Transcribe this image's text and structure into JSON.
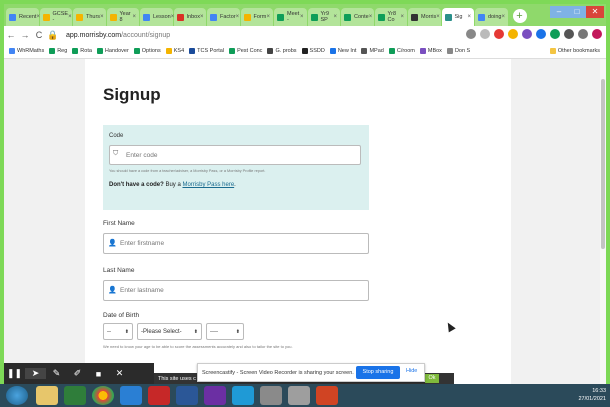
{
  "browser": {
    "tabs": [
      {
        "label": "Recent",
        "color": "#4285f4"
      },
      {
        "label": "GCSE -",
        "color": "#f4b400"
      },
      {
        "label": "Thurs",
        "color": "#f4b400"
      },
      {
        "label": "Year 8",
        "color": "#f4b400"
      },
      {
        "label": "Lesson",
        "color": "#4285f4"
      },
      {
        "label": "Inbox",
        "color": "#d93025"
      },
      {
        "label": "Factor",
        "color": "#4285f4"
      },
      {
        "label": "Form",
        "color": "#f4b400"
      },
      {
        "label": "Meet -",
        "color": "#0f9d58"
      },
      {
        "label": "Yr9 SP",
        "color": "#0f9d58"
      },
      {
        "label": "Conte",
        "color": "#0f9d58"
      },
      {
        "label": "Yr8 Co",
        "color": "#0f9d58"
      },
      {
        "label": "Morris",
        "color": "#333333"
      },
      {
        "label": "Sig",
        "color": "#2a8f8a",
        "active": true
      },
      {
        "label": "doing",
        "color": "#4285f4"
      }
    ],
    "url_host": "app.morrisby.com",
    "url_path": "/account/signup",
    "bookmarks": [
      {
        "label": "WhRMaths",
        "color": "#4285f4"
      },
      {
        "label": "Reg",
        "color": "#0f9d58"
      },
      {
        "label": "Rota",
        "color": "#0f9d58"
      },
      {
        "label": "Handover",
        "color": "#0f9d58"
      },
      {
        "label": "Options",
        "color": "#0f9d58"
      },
      {
        "label": "KS4",
        "color": "#f4b400"
      },
      {
        "label": "TCS Portal",
        "color": "#1a4b9a"
      },
      {
        "label": "Pest Conc",
        "color": "#0f9d58"
      },
      {
        "label": "G. probs",
        "color": "#444444"
      },
      {
        "label": "SSDD",
        "color": "#222222"
      },
      {
        "label": "New Int",
        "color": "#1a73e8"
      },
      {
        "label": "MPad",
        "color": "#555555"
      },
      {
        "label": "C/room",
        "color": "#0f9d58"
      },
      {
        "label": "MBox",
        "color": "#7a4fc0"
      },
      {
        "label": "Don S",
        "color": "#888888"
      }
    ],
    "other_bookmarks": "Other bookmarks"
  },
  "page": {
    "title": "Signup",
    "code": {
      "label": "Code",
      "placeholder": "Enter code",
      "help": "You should have a code from a teacher/adviser, a Morrisby Pass, or a Morrisby Profile report.",
      "no_code": "Don't have a code?",
      "buy_prefix": " Buy a ",
      "buy_link": "Morrisby Pass here",
      "buy_suffix": "."
    },
    "first_name": {
      "label": "First Name",
      "placeholder": "Enter firstname"
    },
    "last_name": {
      "label": "Last Name",
      "placeholder": "Enter lastname"
    },
    "dob": {
      "label": "Date of Birth",
      "day": "--",
      "month": "-Please Select-",
      "year": "----",
      "help": "We need to know your age to be able to score the assessments accurately and also to tailor the site to you."
    }
  },
  "overlay": {
    "share_text": "Screencastify - Screen Video Recorder is sharing your screen.",
    "stop_sharing": "Stop sharing",
    "hide": "Hide",
    "cookie_text": "This site uses c",
    "cookie_more": "more",
    "cookie_ok": "Ok"
  },
  "taskbar": {
    "time": "16:33",
    "date": "27/01/2021"
  }
}
